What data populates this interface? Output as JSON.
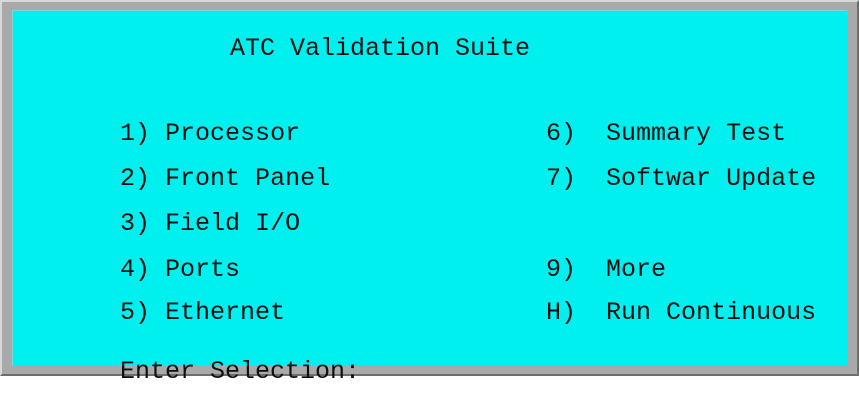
{
  "title": "ATC Validation Suite",
  "menu": {
    "left": [
      {
        "key": "1)",
        "label": "Processor"
      },
      {
        "key": "2)",
        "label": "Front Panel"
      },
      {
        "key": "3)",
        "label": "Field I/O"
      },
      {
        "key": "4)",
        "label": "Ports"
      },
      {
        "key": "5)",
        "label": "Ethernet"
      }
    ],
    "right": [
      {
        "key": "6)",
        "label": "Summary Test"
      },
      {
        "key": "7)",
        "label": "Softwar Update"
      },
      {
        "key": "9)",
        "label": "More"
      },
      {
        "key": "H)",
        "label": "Run Continuous"
      }
    ]
  },
  "prompt": {
    "label": "Enter Selection:",
    "value": ""
  },
  "colors": {
    "screen_background": "#00f0f0",
    "text": "#101010",
    "frame": "#a9a9a9"
  }
}
